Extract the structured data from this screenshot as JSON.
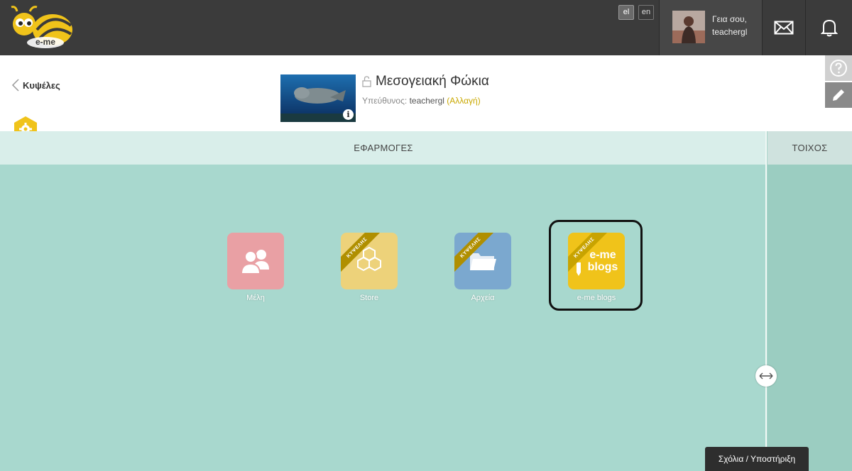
{
  "brand": {
    "logo_text": "e-me"
  },
  "languages": [
    {
      "code": "el",
      "active": true
    },
    {
      "code": "en",
      "active": false
    }
  ],
  "user": {
    "greeting": "Γεια σου,",
    "username": "teachergl"
  },
  "header": {
    "back_label": "Κυψέλες",
    "group_title": "Μεσογειακή Φώκια",
    "owner_label": "Υπεύθυνος:",
    "owner_name": "teachergl",
    "change_label": "(Αλλαγή)",
    "info_glyph": "i"
  },
  "tabs": {
    "apps": "ΕΦΑΡΜΟΓΕΣ",
    "wall": "ΤΟΙΧΟΣ"
  },
  "apps": [
    {
      "label": "Μέλη",
      "color": "#e9a0a4",
      "icon": "members-icon"
    },
    {
      "label": "Store",
      "color": "#edd27a",
      "icon": "honeycomb-icon",
      "ribbon": "ΚΥΨΕΛΗΣ"
    },
    {
      "label": "Αρχεία",
      "color": "#7ba8cf",
      "icon": "folder-icon",
      "ribbon": "ΚΥΨΕΛΗΣ"
    },
    {
      "label": "e-me blogs",
      "color": "#f0c31a",
      "icon": "blog-icon",
      "ribbon": "ΚΥΨΕΛΗΣ",
      "tile_text": "e-me blogs"
    }
  ],
  "footer": {
    "feedback_label": "Σχόλια / Υποστήριξη"
  },
  "colors": {
    "accent": "#f0c31a",
    "topbar": "#3b3b3b",
    "content_bg": "#a8d8ce"
  }
}
